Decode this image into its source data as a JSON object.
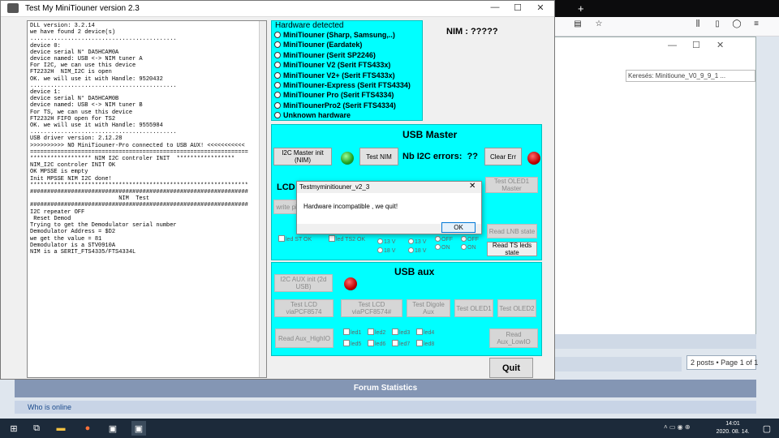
{
  "browser": {
    "tab_new": "+",
    "inner_search": "Keresés: Minitioune_V0_9_9_1 ...",
    "posts": "2 posts • Page 1 of 1",
    "forum_stats": "Forum Statistics",
    "who_online": "Who is online"
  },
  "app": {
    "title": "Test My MiniTiouner version 2.3",
    "nim_label": "NIM : ?????",
    "log_lines": [
      "DLL version: 3.2.14",
      "we have found 2 device(s)",
      "...........................................",
      "device 0:",
      "device serial N° DA5HCAM0A",
      "device named: USB <-> NIM tuner A",
      "For I2C, we can use this device",
      "FT2232H  NIM_I2C is open",
      "OK. we will use it with Handle: 9520432",
      "...........................................",
      "device 1:",
      "device serial N° DA5HCAM0B",
      "device named: USB <-> NIM tuner B",
      "For TS, we can use this device",
      "FT2232H FIFO open for TS2",
      "OK. we will use it with Handle: 9555984",
      "...........................................",
      "USB driver version: 2.12.28",
      ">>>>>>>>>> NO MiniTiouner-Pro connected to USB AUX! <<<<<<<<<<<",
      "================================================================",
      "****************** NIM I2C controler INIT  *****************",
      "NIM_I2C controler INIT OK",
      "OK MPSSE is empty",
      "Init MPSSE NIM I2C done!",
      "****************************************************************",
      "################################################################",
      "                          NIM  Test",
      "################################################################",
      "I2C repeater OFF",
      " Reset Demod",
      "Trying to get the Demodulator serial number",
      "Demodulator Address = $D2",
      "we get the value = 81",
      "Demodulator is a STV0910A",
      "NIM is a SERIT_FTS4335/FTS4334L"
    ],
    "hardware": {
      "title": "Hardware detected",
      "options": [
        "MiniTiouner (Sharp, Samsung,..)",
        "MiniTiouner (Eardatek)",
        "MiniTiouner (Serit SP2246)",
        "MiniTiouner V2 (Serit FTS433x)",
        "MiniTiouner V2+ (Serit FTS433x)",
        "MiniTiouner-Express (Serit FTS4334)",
        "MiniTiouner Pro  (Serit FTS4334)",
        "MiniTiounerPro2 (Serit FTS4334)",
        "Unknown hardware"
      ]
    },
    "usb_master": {
      "title": "USB Master",
      "i2c_master_init": "I2C Master init (NIM)",
      "test_nim": "Test NIM",
      "nb_i2c_errors": "Nb I2C errors:",
      "errors_value": "??",
      "clear_err": "Clear Err",
      "lcd_label": "LCD",
      "test_oled1_master": "Test OLED1 Master",
      "write_pic": "write pic",
      "led_a": "led",
      "st_ok": "ST OK",
      "led_b": "led",
      "ts2_ok": "TS2 OK",
      "v13a": "13 V",
      "v18a": "18 V",
      "v13b": "13 V",
      "v18b": "18 V",
      "offa": "OFF",
      "ona": "ON",
      "offb": "OFF",
      "onb": "ON",
      "read_lnb_state": "Read LNB state",
      "read_ts_leds_state": "Read TS leds state"
    },
    "usb_aux": {
      "title": "USB aux",
      "i2c_aux_init": "I2C AUX init (2d USB)",
      "test_lcd1": "Test LCD viaPCF8574",
      "test_lcd2": "Test LCD viaPCF8574#",
      "test_digole": "Test Digole Aux",
      "test_oled1": "Test OLED1",
      "test_oled2": "Test OLED2",
      "read_aux_high": "Read Aux_HighIO",
      "read_aux_low": "Read Aux_LowIO",
      "leds": [
        "led1",
        "led2",
        "led3",
        "led4",
        "led5",
        "led6",
        "led7",
        "led8"
      ]
    },
    "quit": "Quit"
  },
  "dialog": {
    "title": "Testmyminitiouner_v2_3",
    "message": "Hardware incompatible , we quit!",
    "ok": "OK",
    "close": "✕"
  },
  "taskbar": {
    "time": "14:01",
    "date": "2020. 08. 14."
  },
  "colors": {
    "cyan": "#00ffff",
    "led_red": "#c00000",
    "led_green": "#20a020"
  }
}
